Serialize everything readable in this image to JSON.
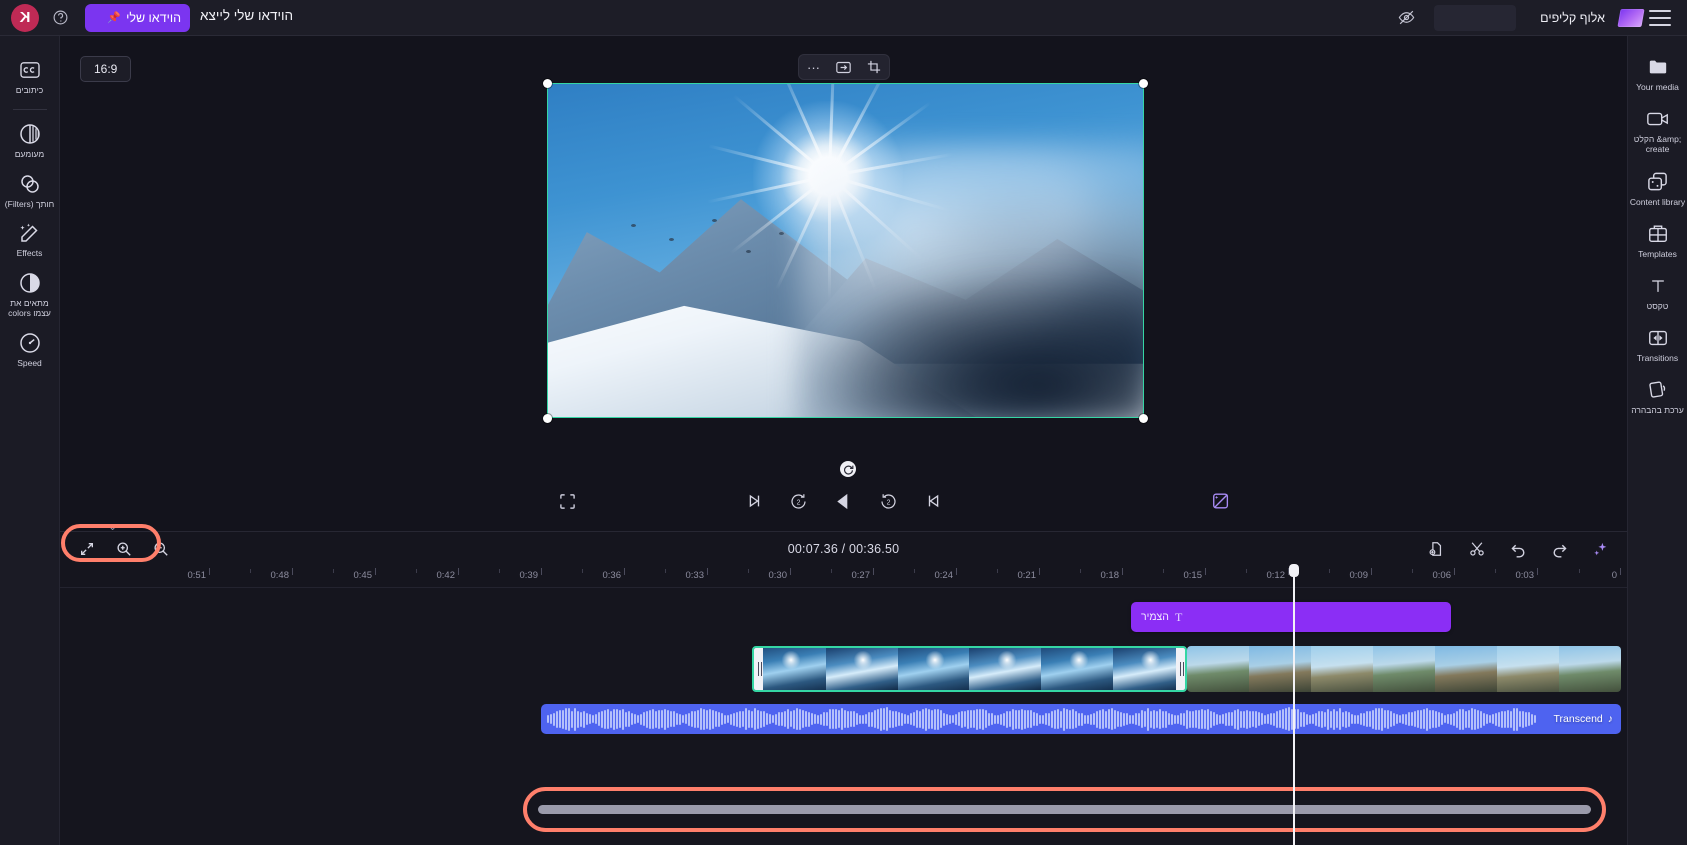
{
  "app": {
    "brand_name": "אלוף קליפים",
    "accent_purple": "#7b35f0",
    "accent_green": "#35d6a4",
    "accent_blue": "#4e63f0",
    "highlight_red": "#ff7f6b"
  },
  "topbar": {
    "logo_glyph": "K",
    "help_icon": "help-circle-icon",
    "project_name": "הוידאו שלי",
    "project_title": "הוידאו שלי לייצא",
    "pin_icon": "pin-icon",
    "eye_off_icon": "eye-off-icon",
    "menu_icon": "hamburger-menu-icon",
    "blank_field_value": ""
  },
  "left_rail": {
    "items": [
      {
        "label": "כיתובים",
        "icon": "captions-icon"
      },
      {
        "label": "מעומעם",
        "icon": "fade-icon"
      },
      {
        "label": "חותך (Filters)",
        "icon": "filters-icon"
      },
      {
        "label": "Effects",
        "icon": "effects-wand-icon"
      },
      {
        "label": "מתאים את עצמו colors",
        "icon": "colors-contrast-icon"
      },
      {
        "label": "Speed",
        "icon": "speed-gauge-icon"
      }
    ],
    "collapse_icon": "chevron-right-icon"
  },
  "right_rail": {
    "items": [
      {
        "label": "Your media",
        "icon": "folder-media-icon"
      },
      {
        "label": "הקלט &amp; create",
        "icon": "record-create-icon"
      },
      {
        "label": "Content library",
        "icon": "content-library-icon"
      },
      {
        "label": "Templates",
        "icon": "templates-grid-icon"
      },
      {
        "label": "טקסט",
        "icon": "text-t-icon"
      },
      {
        "label": "Transitions",
        "icon": "transitions-icon"
      },
      {
        "label": "ערכת בהבהרה",
        "icon": "brand-kit-icon"
      }
    ],
    "collapse_icon": "chevron-left-icon"
  },
  "stage": {
    "aspect_ratio_label": "16:9",
    "float_toolbar": [
      {
        "icon": "more-options-icon",
        "glyph": "···"
      },
      {
        "icon": "fit-frame-icon",
        "glyph": "⊡"
      },
      {
        "icon": "crop-icon",
        "glyph": "⬚"
      }
    ],
    "rotate_handle_icon": "rotate-icon",
    "selection_handles": 4
  },
  "player": {
    "fullscreen_icon": "fullscreen-icon",
    "controls": [
      {
        "icon": "skip-to-start-icon"
      },
      {
        "icon": "rewind-2s-icon",
        "label": "2"
      },
      {
        "icon": "play-icon"
      },
      {
        "icon": "forward-2s-icon",
        "label": "2"
      },
      {
        "icon": "skip-to-end-icon"
      }
    ],
    "ai_effects_icon": "ai-magic-icon"
  },
  "timeline": {
    "zoom_controls": [
      {
        "icon": "fit-to-window-icon"
      },
      {
        "icon": "zoom-in-icon"
      },
      {
        "icon": "zoom-out-icon"
      }
    ],
    "zoom_controls_highlighted": true,
    "current_time": "00:07.36",
    "total_time": "00:36.50",
    "time_display": "00:07.36 / 00:36.50",
    "actions": [
      {
        "icon": "duplicate-icon"
      },
      {
        "icon": "split-scissors-icon"
      },
      {
        "icon": "undo-icon"
      },
      {
        "icon": "redo-icon"
      },
      {
        "icon": "ai-sparkle-icon"
      }
    ],
    "ruler_ticks": [
      "0",
      "0:03",
      "0:06",
      "0:09",
      "0:12",
      "0:15",
      "0:18",
      "0:21",
      "0:24",
      "0:27",
      "0:30",
      "0:33",
      "0:36",
      "0:39",
      "0:42",
      "0:45",
      "0:48",
      "0:51"
    ],
    "playhead_time": "0:07",
    "text_clip": {
      "label": "הצמיר",
      "icon": "text-t-icon"
    },
    "audio_clip": {
      "label": "Transcend",
      "icon": "music-note-icon"
    },
    "video_clips": [
      {
        "selected": false,
        "thumbs": 7
      },
      {
        "selected": true,
        "thumbs": 6
      }
    ],
    "scrollbar_highlighted": true,
    "collapse_icon": "chevron-down-icon"
  }
}
